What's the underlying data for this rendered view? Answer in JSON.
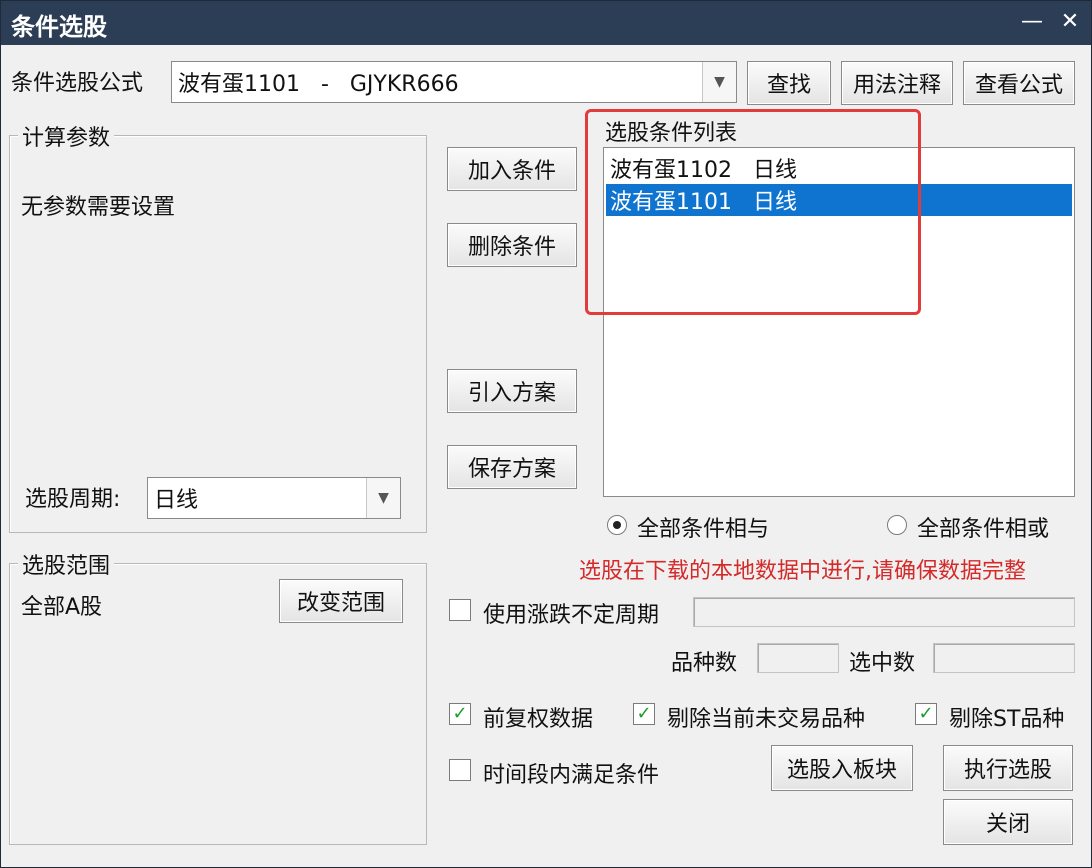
{
  "window": {
    "title": "条件选股",
    "minimize_glyph": "—",
    "close_glyph": "✕"
  },
  "formula": {
    "label": "条件选股公式",
    "value": "波有蛋1101   -   GJYKR666",
    "find_button": "查找",
    "usage_button": "用法注释",
    "view_button": "查看公式"
  },
  "params": {
    "group_title": "计算参数",
    "message": "无参数需要设置",
    "period_label": "选股周期:",
    "period_value": "日线"
  },
  "actions": {
    "add": "加入条件",
    "delete": "删除条件",
    "import": "引入方案",
    "save": "保存方案"
  },
  "conditions": {
    "list_title": "选股条件列表",
    "items": [
      {
        "text": "波有蛋1102   日线",
        "selected": false
      },
      {
        "text": "波有蛋1101   日线",
        "selected": true
      }
    ],
    "radio_and": "全部条件相与",
    "radio_or": "全部条件相或",
    "mode": "and"
  },
  "notice": "选股在下载的本地数据中进行,请确保数据完整",
  "range": {
    "group_title": "选股范围",
    "value": "全部A股",
    "change_button": "改变范围"
  },
  "options": {
    "uncertain_period": {
      "label": "使用涨跌不定周期",
      "checked": false
    },
    "count_label": "品种数",
    "selected_label": "选中数",
    "adjusted": {
      "label": "前复权数据",
      "checked": true
    },
    "exclude_untraded": {
      "label": "剔除当前未交易品种",
      "checked": true
    },
    "exclude_st": {
      "label": "剔除ST品种",
      "checked": true
    },
    "time_range": {
      "label": "时间段内满足条件",
      "checked": false
    }
  },
  "bottom": {
    "to_block": "选股入板块",
    "execute": "执行选股",
    "close": "关闭"
  },
  "colors": {
    "titlebar": "#2c3e55",
    "selection": "#0f74d0",
    "highlight_border": "#e23b3b",
    "notice_text": "#d42a2a",
    "check_mark": "#1a9e2a"
  },
  "icons": {
    "dropdown": "chevron-down-icon",
    "check": "check-icon"
  }
}
